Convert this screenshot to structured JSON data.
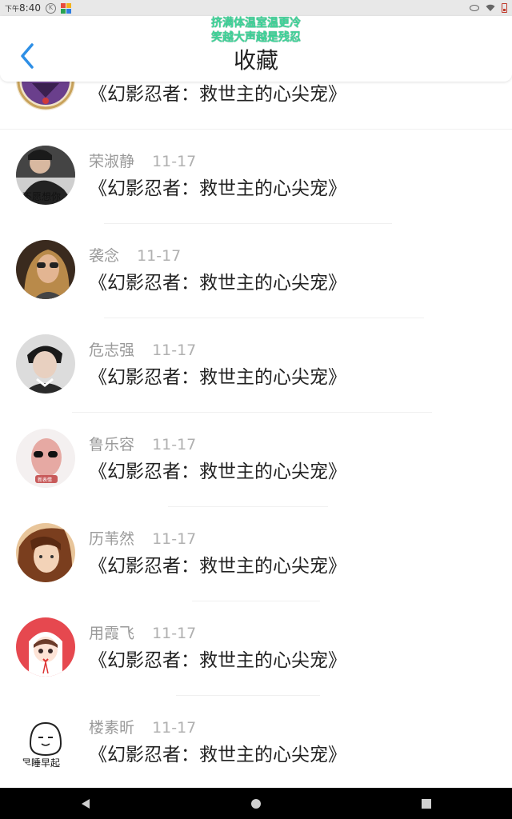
{
  "status_bar": {
    "time_prefix": "下午",
    "time": "8:40"
  },
  "header": {
    "title": "收藏",
    "overlay_line1": "挤满体温室温更冷",
    "overlay_line2": "笑越大声越是残忍"
  },
  "items": [
    {
      "name": "",
      "date": "",
      "title": "《幻影忍者：救世主的心尖宠》",
      "avatar_color": "#6a3f8c"
    },
    {
      "name": "荣淑静",
      "date": "11-17",
      "title": "《幻影忍者：救世主的心尖宠》",
      "avatar_color": "#333333"
    },
    {
      "name": "袭念",
      "date": "11-17",
      "title": "《幻影忍者：救世主的心尖宠》",
      "avatar_color": "#8a6a3e"
    },
    {
      "name": "危志强",
      "date": "11-17",
      "title": "《幻影忍者：救世主的心尖宠》",
      "avatar_color": "#555555"
    },
    {
      "name": "鲁乐容",
      "date": "11-17",
      "title": "《幻影忍者：救世主的心尖宠》",
      "avatar_color": "#e0d6d6"
    },
    {
      "name": "历苇然",
      "date": "11-17",
      "title": "《幻影忍者：救世主的心尖宠》",
      "avatar_color": "#c9784a"
    },
    {
      "name": "用霞飞",
      "date": "11-17",
      "title": "《幻影忍者：救世主的心尖宠》",
      "avatar_color": "#e6484f"
    },
    {
      "name": "楼素昕",
      "date": "11-17",
      "title": "《幻影忍者：救世主的心尖宠》",
      "avatar_color": "#ffffff"
    }
  ],
  "avatar_last_caption": "早睡早起",
  "nav": {
    "back_icon": "triangle-back-icon",
    "home_icon": "circle-home-icon",
    "recents_icon": "square-recents-icon"
  }
}
